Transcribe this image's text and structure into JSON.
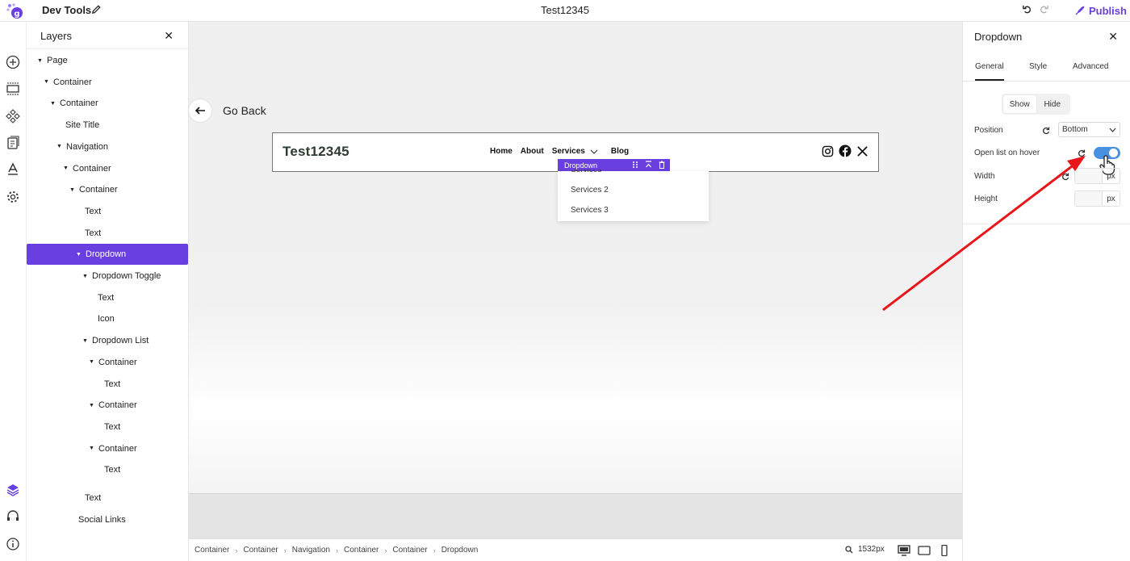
{
  "app": {
    "title": "Dev Tools",
    "document_title": "Test12345",
    "publish_label": "Publish",
    "accent_color": "#6a3fe0"
  },
  "rail": {
    "icons": [
      "add-icon",
      "section-icon",
      "components-icon",
      "pages-icon",
      "typography-icon",
      "settings-icon",
      "layers-icon",
      "support-icon",
      "info-icon"
    ]
  },
  "layers": {
    "title": "Layers",
    "items": [
      {
        "label": "Page",
        "caret": true
      },
      {
        "label": "Container",
        "caret": true
      },
      {
        "label": "Container",
        "caret": true
      },
      {
        "label": "Site Title",
        "caret": false
      },
      {
        "label": "Navigation",
        "caret": true
      },
      {
        "label": "Container",
        "caret": true
      },
      {
        "label": "Container",
        "caret": true
      },
      {
        "label": "Text",
        "caret": false
      },
      {
        "label": "Text",
        "caret": false
      },
      {
        "label": "Dropdown",
        "caret": true,
        "selected": true
      },
      {
        "label": "Dropdown Toggle",
        "caret": true
      },
      {
        "label": "Text",
        "caret": false
      },
      {
        "label": "Icon",
        "caret": false
      },
      {
        "label": "Dropdown List",
        "caret": true
      },
      {
        "label": "Container",
        "caret": true
      },
      {
        "label": "Text",
        "caret": false
      },
      {
        "label": "Container",
        "caret": true
      },
      {
        "label": "Text",
        "caret": false
      },
      {
        "label": "Container",
        "caret": true
      },
      {
        "label": "Text",
        "caret": false
      },
      {
        "label": "Text",
        "caret": false
      },
      {
        "label": "Social Links",
        "caret": false
      }
    ]
  },
  "canvas": {
    "go_back_label": "Go Back",
    "site_title": "Test12345",
    "nav_links": [
      "Home",
      "About",
      "Services",
      "Blog"
    ],
    "dropdown_tag": "Dropdown",
    "dropdown_items": [
      "Services",
      "Services 2",
      "Services 3"
    ]
  },
  "breadcrumb": [
    "Container",
    "Container",
    "Navigation",
    "Container",
    "Container",
    "Dropdown"
  ],
  "zoom_label": "1532px",
  "props": {
    "title": "Dropdown",
    "tabs": [
      "General",
      "Style",
      "Advanced"
    ],
    "active_tab": "General",
    "visibility": {
      "options": [
        "Show",
        "Hide"
      ],
      "selected": "Show"
    },
    "position": {
      "label": "Position",
      "value": "Bottom"
    },
    "open_on_hover": {
      "label": "Open list on hover",
      "enabled": true
    },
    "width": {
      "label": "Width",
      "unit": "px",
      "value": ""
    },
    "height": {
      "label": "Height",
      "unit": "px",
      "value": ""
    }
  }
}
